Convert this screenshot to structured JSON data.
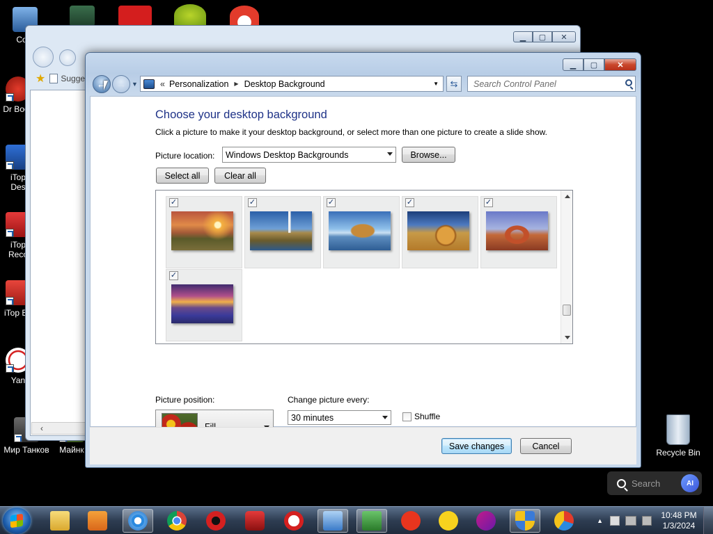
{
  "desktop": {
    "icons": [
      {
        "label": "Com"
      },
      {
        "label": "Dr Boos"
      },
      {
        "label": "iTop Des"
      },
      {
        "label": "iTop Reco"
      },
      {
        "label": "iTop Ed"
      },
      {
        "label": "Yan"
      },
      {
        "label": "Мир Танков"
      },
      {
        "label": "Майнк"
      },
      {
        "label": "Recycle Bin"
      }
    ]
  },
  "back_window": {
    "address_fragment": "Sugge"
  },
  "window": {
    "breadcrumb": [
      "Personalization",
      "Desktop Background"
    ],
    "breadcrumb_prefix": "«",
    "search_placeholder": "Search Control Panel",
    "title": "Choose your desktop background",
    "description": "Click a picture to make it your desktop background, or select more than one picture to create a slide show.",
    "picture_location_label": "Picture location:",
    "picture_location_value": "Windows Desktop Backgrounds",
    "browse_label": "Browse...",
    "select_all_label": "Select all",
    "clear_all_label": "Clear all",
    "thumbnails": [
      {
        "checked": true,
        "theme": "sunset-fields"
      },
      {
        "checked": true,
        "theme": "lighthouse"
      },
      {
        "checked": true,
        "theme": "rock-lake"
      },
      {
        "checked": true,
        "theme": "hay-bale"
      },
      {
        "checked": true,
        "theme": "arch"
      },
      {
        "checked": true,
        "theme": "lake-flowers"
      }
    ],
    "picture_position_label": "Picture position:",
    "picture_position_value": "Fill",
    "change_every_label": "Change picture every:",
    "change_every_value": "30 minutes",
    "shuffle_label": "Shuffle",
    "shuffle_checked": false,
    "save_label": "Save changes",
    "cancel_label": "Cancel"
  },
  "search_widget": {
    "placeholder": "Search",
    "badge": "AI"
  },
  "taskbar": {
    "time": "10:48 PM",
    "date": "1/3/2024"
  }
}
